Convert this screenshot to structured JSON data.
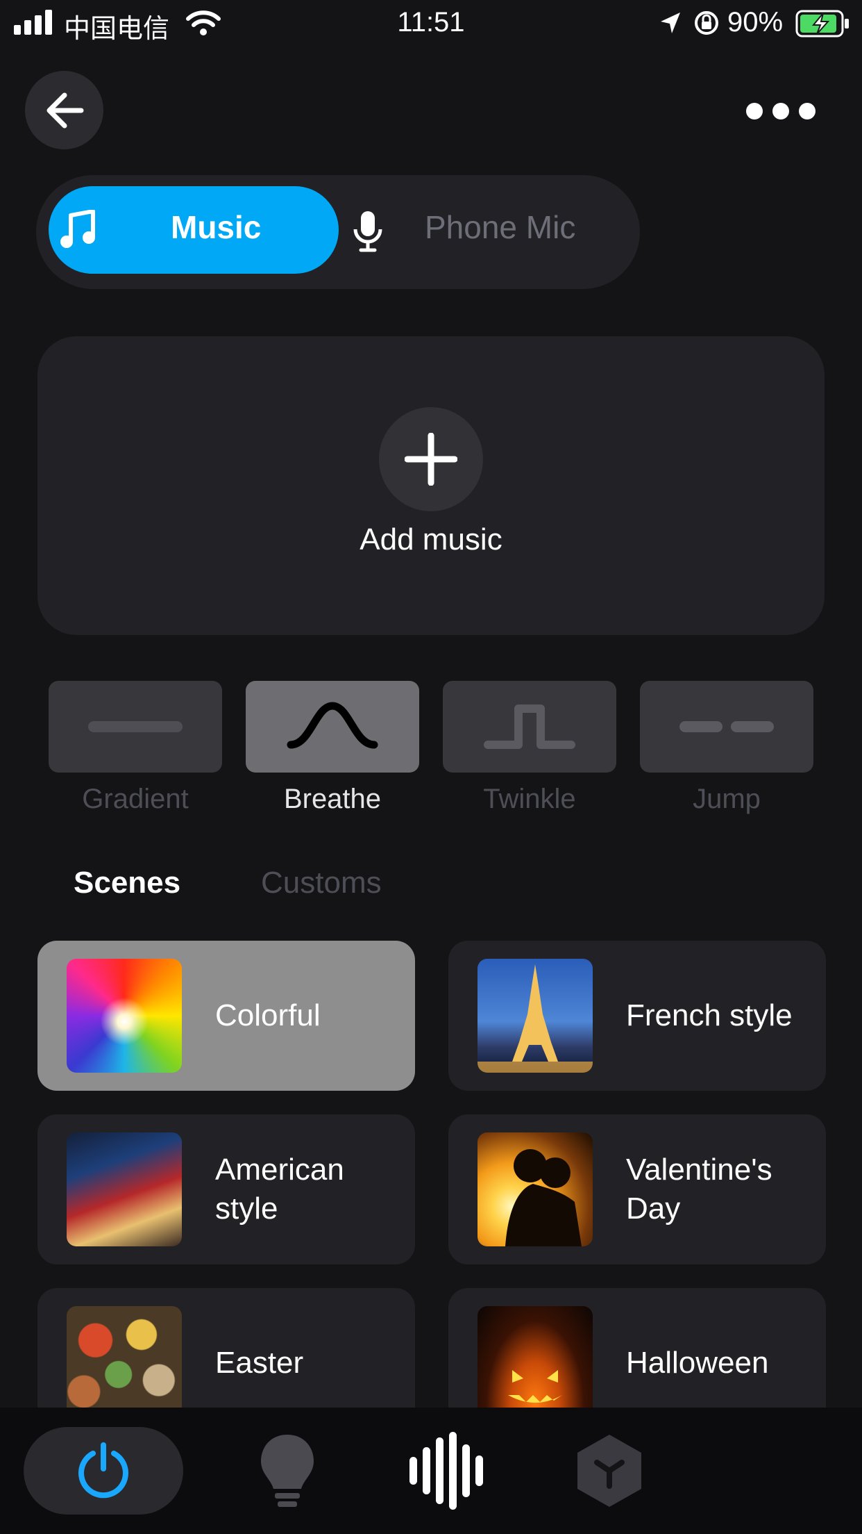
{
  "status_bar": {
    "carrier": "中国电信",
    "time": "11:51",
    "battery_percent": "90%"
  },
  "header": {
    "back_icon": "arrow-left-icon",
    "more_icon": "ellipsis-icon"
  },
  "source_toggle": {
    "music_label": "Music",
    "mic_label": "Phone Mic",
    "selected": "Music"
  },
  "add_music": {
    "label": "Add music"
  },
  "modes": [
    {
      "label": "Gradient",
      "active": false
    },
    {
      "label": "Breathe",
      "active": true
    },
    {
      "label": "Twinkle",
      "active": false
    },
    {
      "label": "Jump",
      "active": false
    }
  ],
  "tabs": {
    "scenes": "Scenes",
    "customs": "Customs",
    "selected": "Scenes"
  },
  "scenes": [
    {
      "label": "Colorful",
      "active": true
    },
    {
      "label": "French style",
      "active": false
    },
    {
      "label": "American style",
      "active": false
    },
    {
      "label": "Valentine's Day",
      "active": false
    },
    {
      "label": "Easter",
      "active": false
    },
    {
      "label": "Halloween",
      "active": false
    }
  ],
  "bottom_nav": {
    "items": [
      "power-icon",
      "bulb-icon",
      "soundwave-icon",
      "cube-icon"
    ],
    "active": "power-icon"
  },
  "colors": {
    "accent": "#00a8f5",
    "background": "#141417",
    "card": "#222226"
  }
}
